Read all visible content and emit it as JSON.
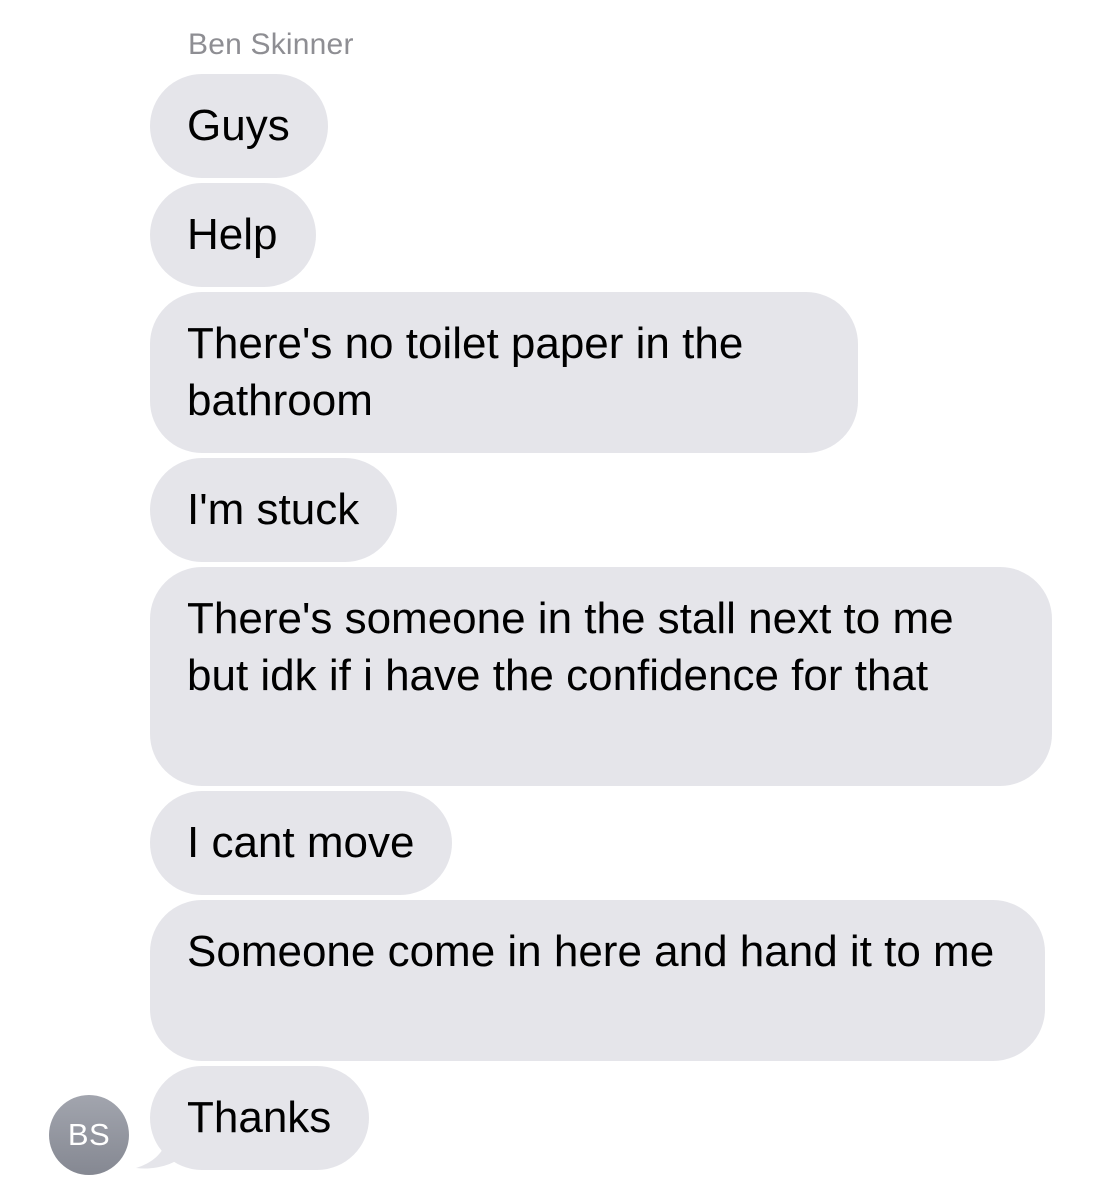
{
  "conversation": {
    "sender_name": "Ben Skinner",
    "avatar_initials": "BS",
    "messages": [
      {
        "text": "Guys"
      },
      {
        "text": "Help"
      },
      {
        "text": "There's no toilet paper in the bathroom"
      },
      {
        "text": "I'm stuck"
      },
      {
        "text": "There's someone in the stall next to me but idk if i have the confidence for that"
      },
      {
        "text": "I cant move"
      },
      {
        "text": "Someone come in here and hand it to me"
      },
      {
        "text": "Thanks"
      }
    ]
  },
  "colors": {
    "incoming_bubble": "#e5e5ea",
    "sender_name_text": "#8e8e93",
    "avatar_background": "#959aa3"
  }
}
